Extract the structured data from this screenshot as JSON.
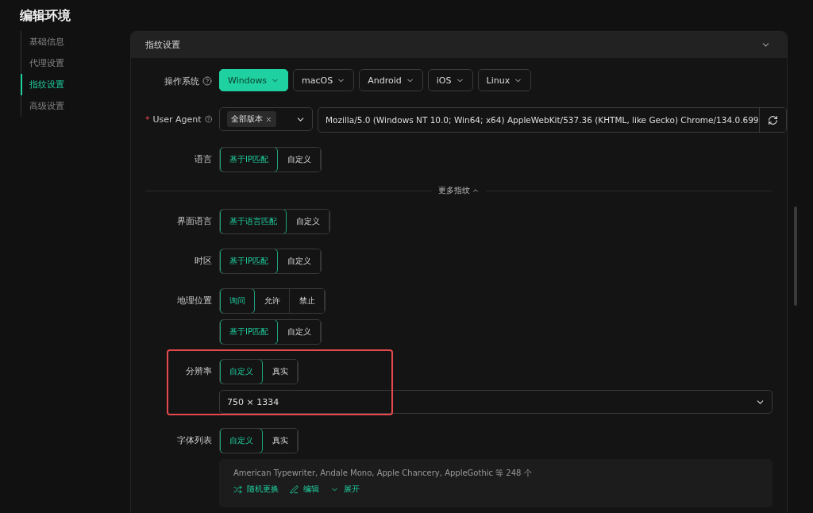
{
  "page_title": "编辑环境",
  "sidebar": {
    "items": [
      {
        "label": "基础信息",
        "selected": false
      },
      {
        "label": "代理设置",
        "selected": false
      },
      {
        "label": "指纹设置",
        "selected": true
      },
      {
        "label": "高级设置",
        "selected": false
      }
    ]
  },
  "panel": {
    "title": "指纹设置",
    "expanded": true,
    "rows": [
      {
        "label": "操作系统",
        "help": true,
        "parts": [
          {
            "kind": "os_menu",
            "options": [
              {
                "label": "Windows",
                "selected": true
              },
              {
                "label": "macOS",
                "selected": false
              },
              {
                "label": "Android",
                "selected": false
              },
              {
                "label": "iOS",
                "selected": false
              },
              {
                "label": "Linux",
                "selected": false
              }
            ]
          }
        ]
      },
      {
        "label": "User Agent",
        "required_mark": "*",
        "help": true,
        "parts": [
          {
            "kind": "ua",
            "tag": "全部版本",
            "value": "Mozilla/5.0 (Windows NT 10.0; Win64; x64) AppleWebKit/537.36 (KHTML, like Gecko) Chrome/134.0.699"
          }
        ]
      },
      {
        "label": "语言",
        "parts": [
          {
            "kind": "segmented",
            "options": [
              {
                "label": "基于IP匹配",
                "selected": true
              },
              {
                "label": "自定义",
                "selected": false
              }
            ]
          }
        ]
      }
    ],
    "more": {
      "label": "更多指纹",
      "expanded": true
    },
    "more_rows": [
      {
        "label": "界面语言",
        "parts": [
          {
            "kind": "segmented",
            "options": [
              {
                "label": "基于语言匹配",
                "selected": true
              },
              {
                "label": "自定义",
                "selected": false
              }
            ]
          }
        ]
      },
      {
        "label": "时区",
        "parts": [
          {
            "kind": "segmented",
            "options": [
              {
                "label": "基于IP匹配",
                "selected": true
              },
              {
                "label": "自定义",
                "selected": false
              }
            ]
          }
        ]
      },
      {
        "label": "地理位置",
        "parts": [
          {
            "kind": "segmented",
            "options": [
              {
                "label": "询问",
                "selected": true
              },
              {
                "label": "允许",
                "selected": false
              },
              {
                "label": "禁止",
                "selected": false
              }
            ]
          },
          {
            "kind": "segmented",
            "options": [
              {
                "label": "基于IP匹配",
                "selected": true
              },
              {
                "label": "自定义",
                "selected": false
              }
            ]
          }
        ]
      },
      {
        "label": "分辨率",
        "highlighted": true,
        "parts": [
          {
            "kind": "segmented",
            "options": [
              {
                "label": "自定义",
                "selected": true
              },
              {
                "label": "真实",
                "selected": false
              }
            ]
          },
          {
            "kind": "select",
            "value": "750 × 1334"
          }
        ]
      },
      {
        "label": "字体列表",
        "parts": [
          {
            "kind": "segmented",
            "options": [
              {
                "label": "自定义",
                "selected": true
              },
              {
                "label": "真实",
                "selected": false
              }
            ]
          },
          {
            "kind": "fonts",
            "summary": "American Typewriter, Andale Mono, Apple Chancery, AppleGothic 等 248 个",
            "actions": [
              {
                "kind": "shuffle",
                "label": "随机更换"
              },
              {
                "kind": "edit",
                "label": "编辑"
              },
              {
                "kind": "expand",
                "label": "展开"
              }
            ]
          }
        ]
      }
    ]
  }
}
